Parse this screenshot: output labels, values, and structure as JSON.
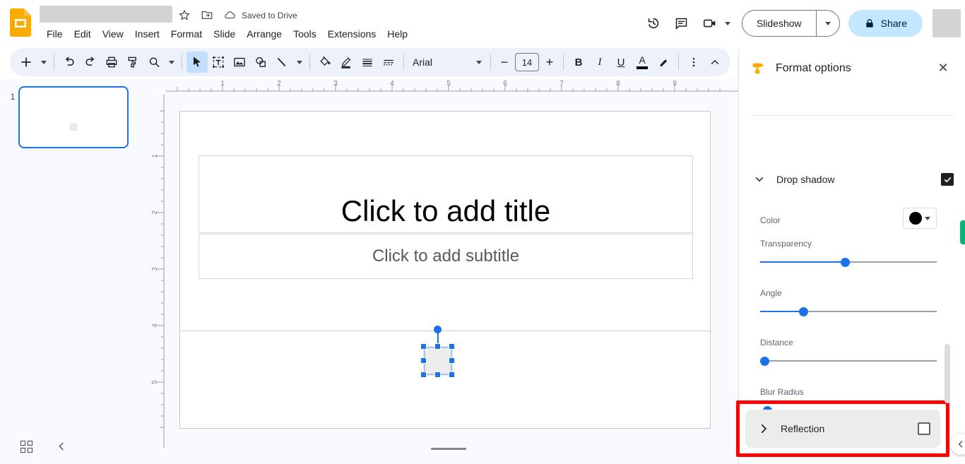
{
  "app": {
    "logo_icon": "google-slides-logo",
    "doc_title": "",
    "doc_title_redacted": true,
    "save_status": "Saved to Drive",
    "title_icons": [
      "star-icon",
      "move-to-folder-icon",
      "cloud-saved-icon"
    ]
  },
  "menubar": {
    "items": [
      {
        "label": "File"
      },
      {
        "label": "Edit"
      },
      {
        "label": "View"
      },
      {
        "label": "Insert"
      },
      {
        "label": "Format"
      },
      {
        "label": "Slide"
      },
      {
        "label": "Arrange"
      },
      {
        "label": "Tools"
      },
      {
        "label": "Extensions"
      },
      {
        "label": "Help"
      }
    ]
  },
  "top_right": {
    "history_icon": "version-history-icon",
    "comment_icon": "comment-icon",
    "meet_icon": "video-camera-icon",
    "slideshow_label": "Slideshow",
    "share_label": "Share",
    "share_icon": "lock-icon",
    "avatar_redacted": true
  },
  "toolbar": {
    "new_slide_icon": "plus-icon",
    "undo_icon": "undo-icon",
    "redo_icon": "redo-icon",
    "print_icon": "print-icon",
    "paint_format_icon": "paint-format-icon",
    "zoom_icon": "zoom-icon",
    "select_icon": "cursor-arrow-icon",
    "textbox_icon": "text-box-icon",
    "image_icon": "image-icon",
    "shape_icon": "shape-icon",
    "line_icon": "line-icon",
    "fill_color_icon": "fill-color-icon",
    "border_color_icon": "border-color-icon",
    "border_weight_icon": "border-weight-icon",
    "border_dash_icon": "border-dash-icon",
    "font_family": "Arial",
    "font_size": "14",
    "decrease_size_label": "−",
    "increase_size_label": "+",
    "bold_label": "B",
    "italic_label": "I",
    "underline_label": "U",
    "text_color_label": "A",
    "highlight_icon": "highlight-pen-icon",
    "more_icon": "more-vertical-icon",
    "collapse_icon": "chevron-up-icon"
  },
  "filmstrip": {
    "slides": [
      {
        "number": "1"
      }
    ],
    "grid_view_icon": "grid-view-icon",
    "collapse_icon": "chevron-left-icon"
  },
  "canvas": {
    "title_placeholder": "Click to add title",
    "subtitle_placeholder": "Click to add subtitle",
    "ruler_h_ticks": [
      "1",
      "2",
      "3",
      "4",
      "5",
      "6",
      "7",
      "8",
      "9"
    ],
    "ruler_v_ticks": [
      "1",
      "2",
      "3",
      "4",
      "5"
    ],
    "selected_shape": "square-shape",
    "notes_handle": "notes-resize-handle"
  },
  "panel": {
    "icon": "paint-roller-icon",
    "title": "Format options",
    "close_label": "✕",
    "sections": [
      {
        "id": "drop-shadow",
        "label": "Drop shadow",
        "expanded": true,
        "checked": true,
        "fields": {
          "color_label": "Color",
          "color_value": "#000000",
          "transparency_label": "Transparency",
          "transparency_pct": 50,
          "angle_label": "Angle",
          "angle_pct": 25,
          "distance_label": "Distance",
          "distance_pct": 2,
          "blur_label": "Blur Radius",
          "blur_pct": 4
        }
      },
      {
        "id": "reflection",
        "label": "Reflection",
        "expanded": false,
        "checked": false
      }
    ],
    "highlight_color": "#ff0000",
    "collapse_icon": "chevron-left-icon",
    "green_tab_color": "#00b87c"
  }
}
